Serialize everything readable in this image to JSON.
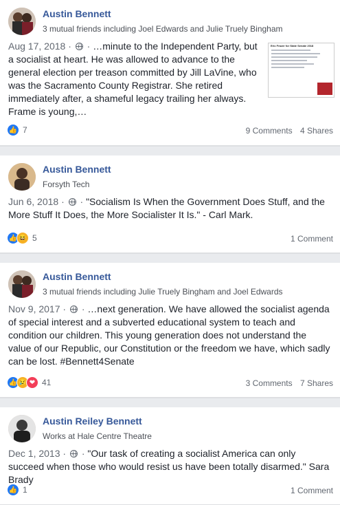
{
  "posts": [
    {
      "author": "Austin Bennett",
      "subtitle": "3 mutual friends including Joel Edwards and Julie Truely Bingham",
      "date": "Aug 17, 2018",
      "separator": "·",
      "text": "…minute to the Independent Party, but a socialist at heart. He was allowed to advance to the general election per treason committed by Jill LaVine, who was the Sacramento County Registrar. She retired immediately after, a shameful legacy trailing her always. Frame is young,…",
      "reactions": [
        "like"
      ],
      "reaction_count": "7",
      "comments": "9 Comments",
      "shares": "4 Shares",
      "thumbnail_title": "Eric Frazer for State Senate 2018"
    },
    {
      "author": "Austin Bennett",
      "subtitle": "Forsyth Tech",
      "date": "Jun 6, 2018",
      "separator": "·",
      "text": "\"Socialism Is When the Government Does Stuff, and the More Stuff It Does, the More Socialister It Is.\" - Carl Mark.",
      "reactions": [
        "like",
        "haha"
      ],
      "reaction_count": "5",
      "comments": "1 Comment",
      "shares": ""
    },
    {
      "author": "Austin Bennett",
      "subtitle": "3 mutual friends including Julie Truely Bingham and Joel Edwards",
      "date": "Nov 9, 2017",
      "separator": "·",
      "text": "…next generation. We have allowed the socialist agenda of special interest and a subverted educational system to teach and condition our children. This young generation does not understand the value of our Republic, our Constitution or the freedom we have, which sadly can be lost. #Bennett4Senate",
      "reactions": [
        "like",
        "sad",
        "love"
      ],
      "reaction_count": "41",
      "comments": "3 Comments",
      "shares": "7 Shares"
    },
    {
      "author": "Austin Reiley Bennett",
      "subtitle": "Works at Hale Centre Theatre",
      "date": "Dec 1, 2013",
      "separator": "·",
      "text": "\"Our task of creating a socialist America can only succeed when those who would resist us have been totally disarmed.\" Sara Brady",
      "reactions": [
        "like"
      ],
      "reaction_count": "1",
      "comments": "1 Comment",
      "shares": ""
    }
  ],
  "colors": {
    "name": "#365899",
    "like": "#2078f4",
    "love": "#f33e58",
    "haha": "#f7b125"
  }
}
